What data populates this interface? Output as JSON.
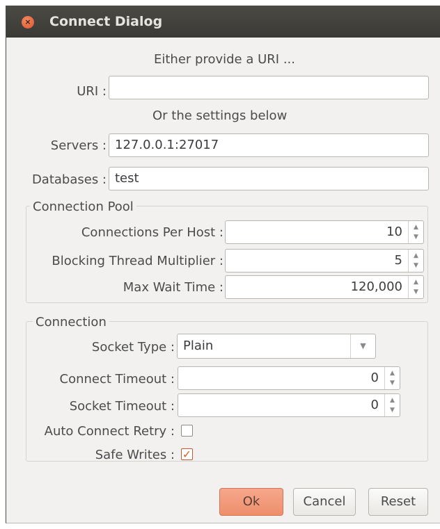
{
  "window": {
    "title": "Connect Dialog",
    "close_glyph": "×"
  },
  "uri_section": {
    "hint": "Either provide a URI ...",
    "label": "URI :",
    "value": ""
  },
  "settings_hint": "Or the settings below",
  "servers": {
    "label": "Servers :",
    "value": "127.0.0.1:27017"
  },
  "databases": {
    "label": "Databases :",
    "value": "test"
  },
  "connection_pool": {
    "title": "Connection Pool",
    "connections_per_host": {
      "label": "Connections Per Host :",
      "value": "10"
    },
    "blocking_thread_multiplier": {
      "label": "Blocking Thread Multiplier :",
      "value": "5"
    },
    "max_wait_time": {
      "label": "Max Wait Time :",
      "value": "120,000"
    }
  },
  "connection": {
    "title": "Connection",
    "socket_type": {
      "label": "Socket Type :",
      "value": "Plain"
    },
    "connect_timeout": {
      "label": "Connect Timeout :",
      "value": "0"
    },
    "socket_timeout": {
      "label": "Socket Timeout :",
      "value": "0"
    },
    "auto_connect_retry": {
      "label": "Auto Connect Retry :",
      "checked": false
    },
    "safe_writes": {
      "label": "Safe Writes :",
      "checked": true,
      "check_glyph": "✓"
    }
  },
  "buttons": {
    "ok": "Ok",
    "cancel": "Cancel",
    "reset": "Reset"
  },
  "icons": {
    "spin_up": "▲",
    "spin_down": "▼",
    "dropdown": "▼"
  },
  "colors": {
    "titlebar": "#3f3e3a",
    "accent": "#e0602f",
    "primary_button": "#f29a78"
  }
}
